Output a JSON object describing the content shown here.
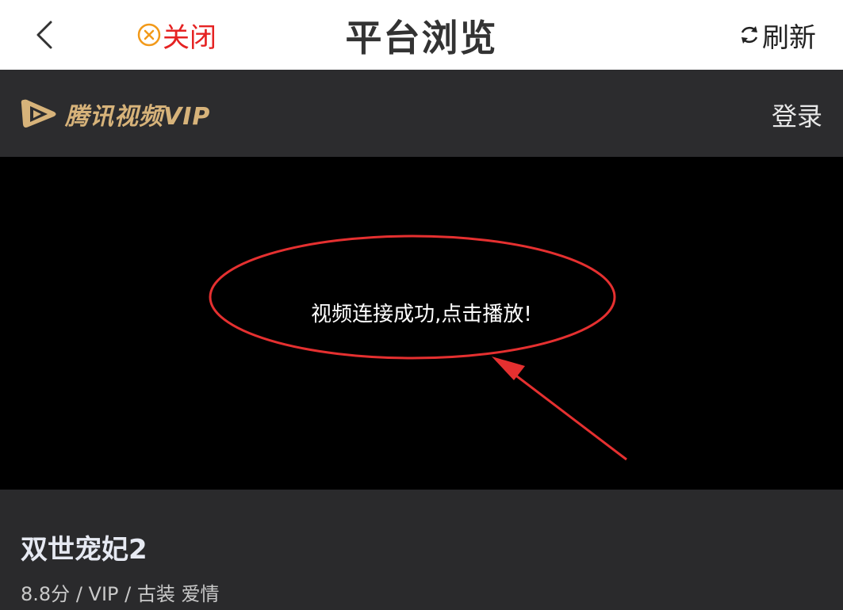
{
  "topbar": {
    "back_icon": "chevron-left-icon",
    "close_icon": "circle-x-icon",
    "close_label": "关闭",
    "title": "平台浏览",
    "refresh_icon": "refresh-icon",
    "refresh_label": "刷新"
  },
  "site": {
    "logo_icon": "play-logo-icon",
    "logo_text": "腾讯视频VIP",
    "login_label": "登录"
  },
  "player": {
    "message": "视频连接成功,点击播放!"
  },
  "show": {
    "title": "双世宠妃2",
    "score": "8.8分",
    "badge": "VIP",
    "genres": "古装 爱情"
  },
  "colors": {
    "close_red": "#e52222",
    "close_icon_orange": "#f29a1a",
    "logo_gold": "#d7b37a",
    "annotation_red": "#e53030"
  }
}
